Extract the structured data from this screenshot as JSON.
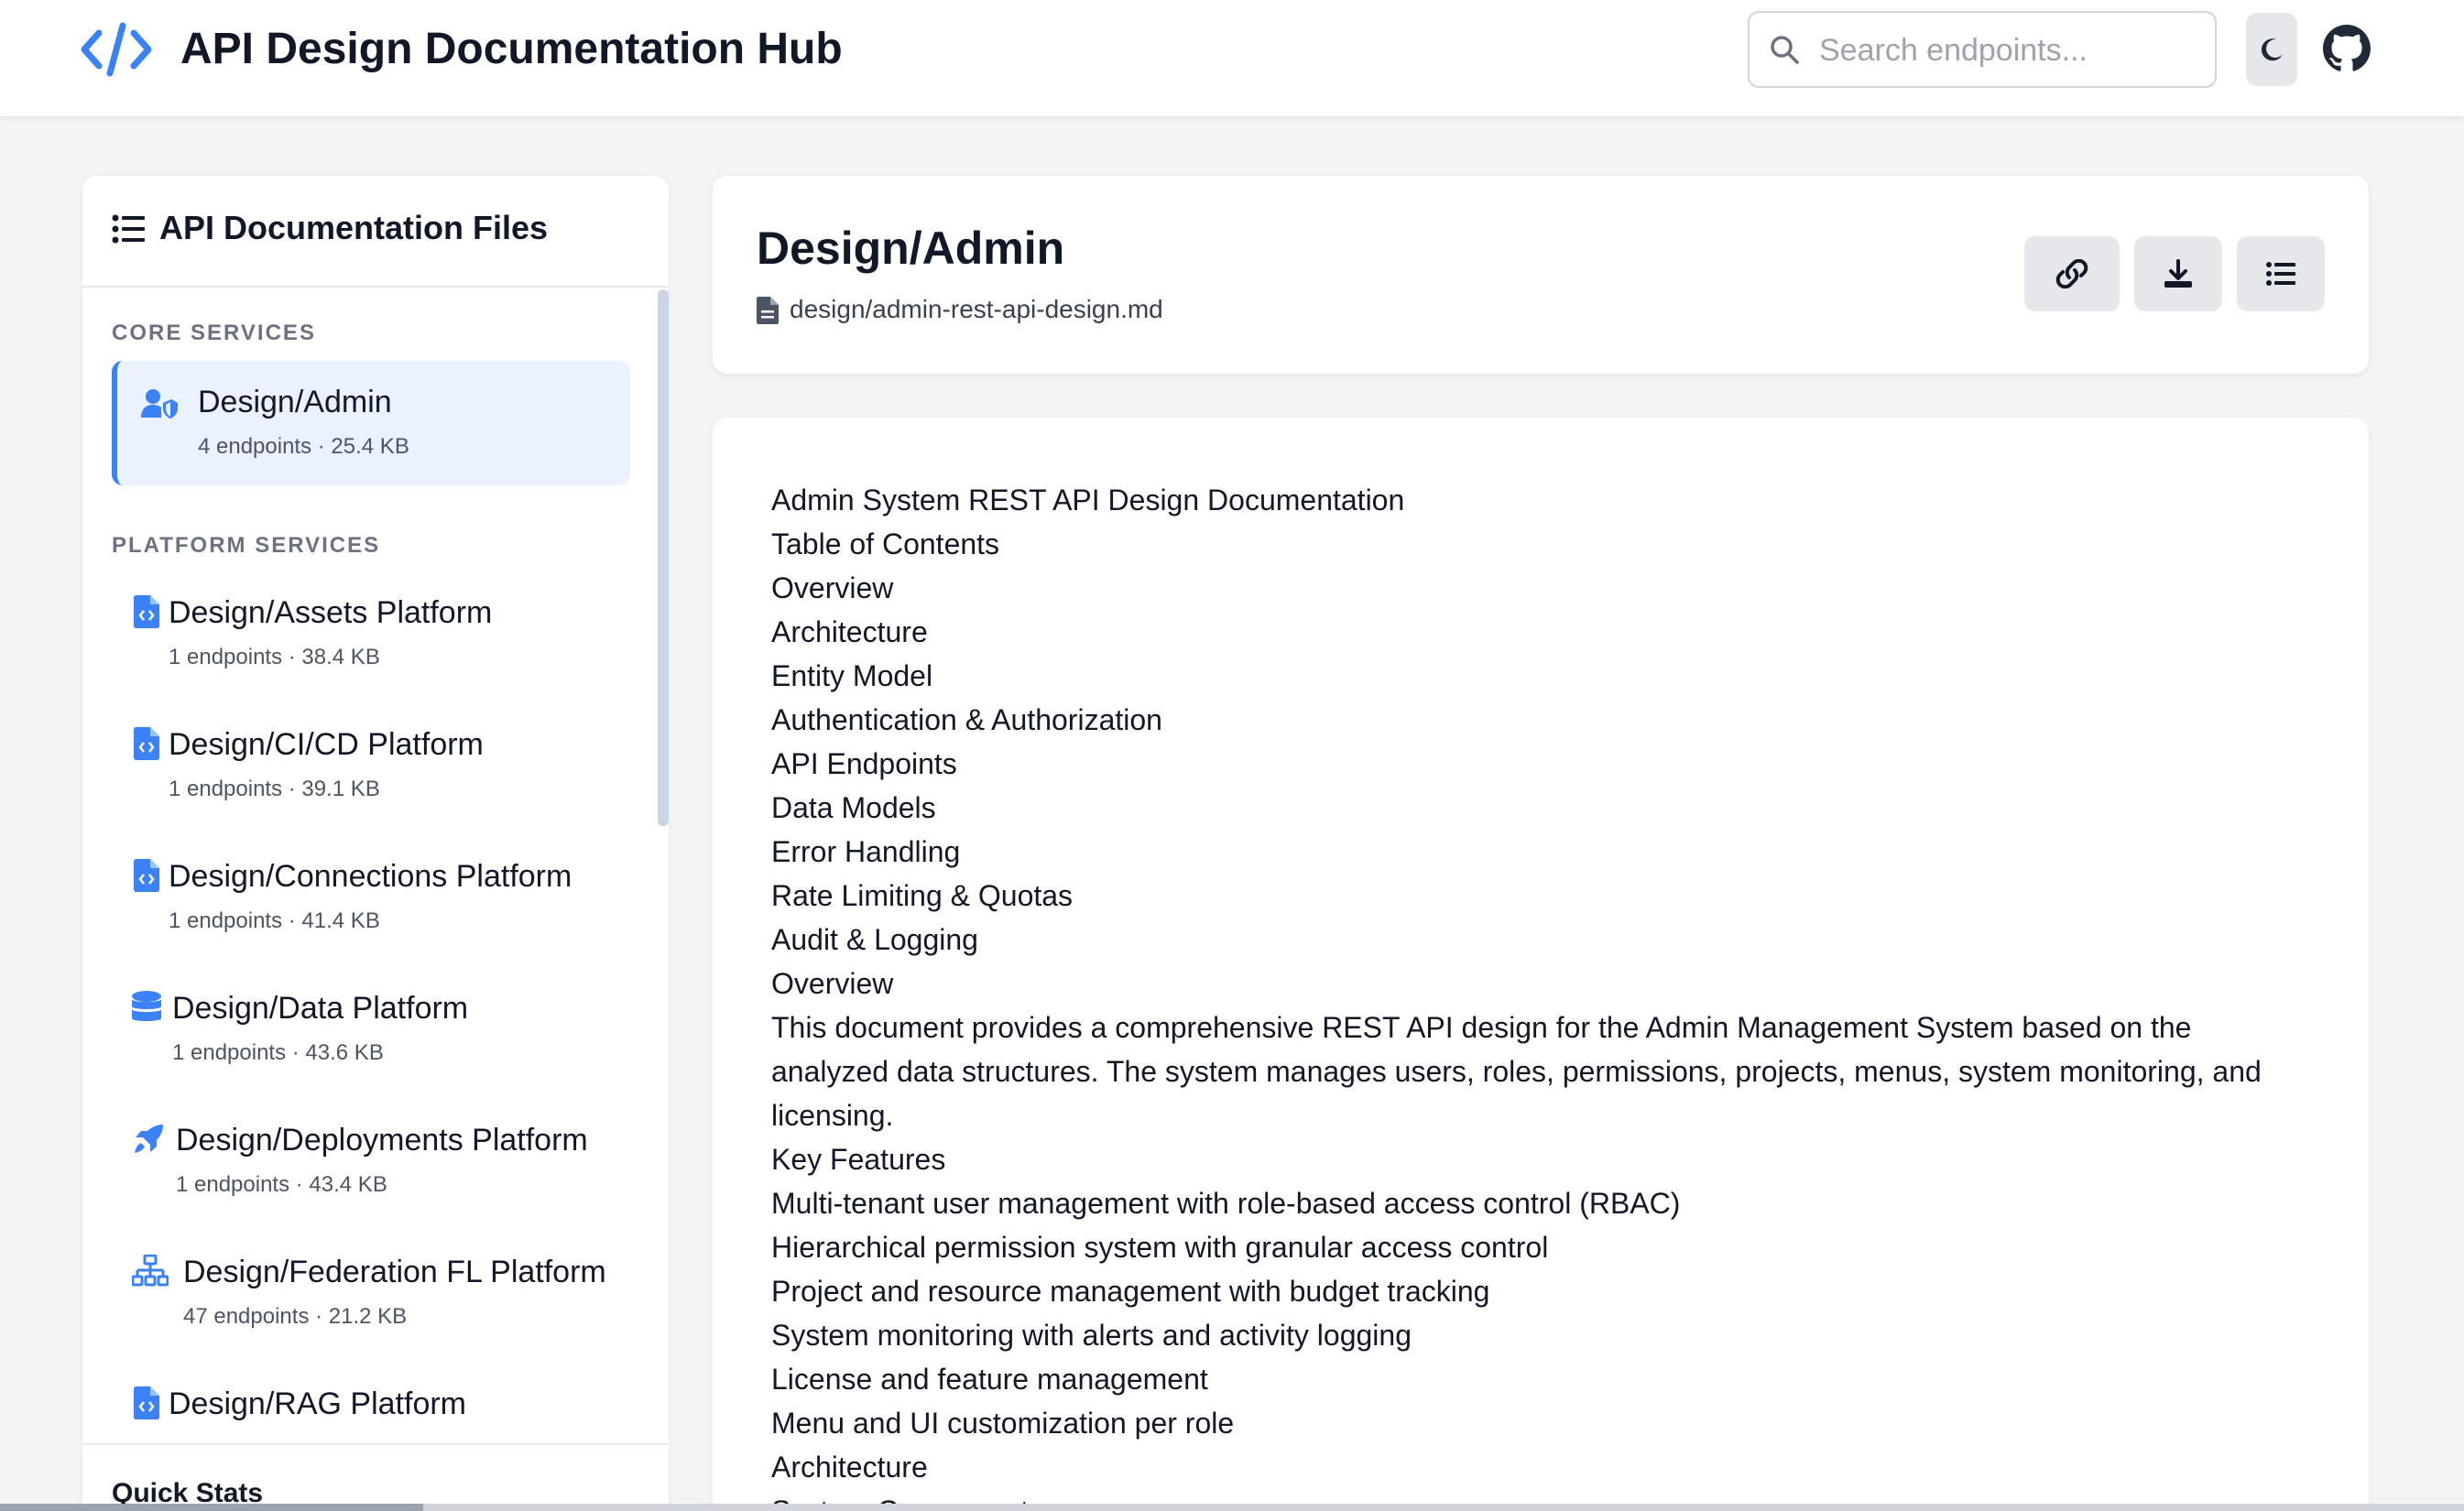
{
  "app": {
    "title": "API Design Documentation Hub",
    "accent_color": "#3b82f6",
    "icons": {
      "logo": "code-brackets-icon",
      "search": "search-icon",
      "theme": "moon-icon",
      "github": "github-icon"
    }
  },
  "search": {
    "placeholder": "Search endpoints...",
    "value": ""
  },
  "sidebar": {
    "title": "API Documentation Files",
    "sections": [
      {
        "label": "CORE SERVICES",
        "items": [
          {
            "name": "Design/Admin",
            "meta": "4 endpoints · 25.4 KB",
            "icon": "user-shield-icon",
            "active": true
          }
        ]
      },
      {
        "label": "PLATFORM SERVICES",
        "items": [
          {
            "name": "Design/Assets Platform",
            "meta": "1 endpoints · 38.4 KB",
            "icon": "file-code-icon"
          },
          {
            "name": "Design/CI/CD Platform",
            "meta": "1 endpoints · 39.1 KB",
            "icon": "file-code-icon"
          },
          {
            "name": "Design/Connections Platform",
            "meta": "1 endpoints · 41.4 KB",
            "icon": "file-code-icon"
          },
          {
            "name": "Design/Data Platform",
            "meta": "1 endpoints · 43.6 KB",
            "icon": "database-icon"
          },
          {
            "name": "Design/Deployments Platform",
            "meta": "1 endpoints · 43.4 KB",
            "icon": "rocket-icon"
          },
          {
            "name": "Design/Federation FL Platform",
            "meta": "47 endpoints · 21.2 KB",
            "icon": "network-icon"
          },
          {
            "name": "Design/RAG Platform",
            "meta": "",
            "icon": "file-code-icon"
          }
        ]
      }
    ],
    "footer_title": "Quick Stats"
  },
  "document": {
    "title": "Design/Admin",
    "path": "design/admin-rest-api-design.md",
    "actions": [
      {
        "name": "copy-link-button",
        "icon": "link-icon"
      },
      {
        "name": "download-button",
        "icon": "download-icon"
      },
      {
        "name": "toc-button",
        "icon": "list-icon"
      }
    ],
    "lines": [
      "Admin System REST API Design Documentation",
      "Table of Contents",
      "Overview",
      "Architecture",
      "Entity Model",
      "Authentication & Authorization",
      "API Endpoints",
      "Data Models",
      "Error Handling",
      "Rate Limiting & Quotas",
      "Audit & Logging",
      "Overview",
      "This document provides a comprehensive REST API design for the Admin Management System based on the analyzed data structures. The system manages users, roles, permissions, projects, menus, system monitoring, and licensing.",
      "Key Features",
      "Multi-tenant user management with role-based access control (RBAC)",
      "Hierarchical permission system with granular access control",
      "Project and resource management with budget tracking",
      "System monitoring with alerts and activity logging",
      "License and feature management",
      "Menu and UI customization per role",
      "Architecture",
      "System Components"
    ]
  }
}
